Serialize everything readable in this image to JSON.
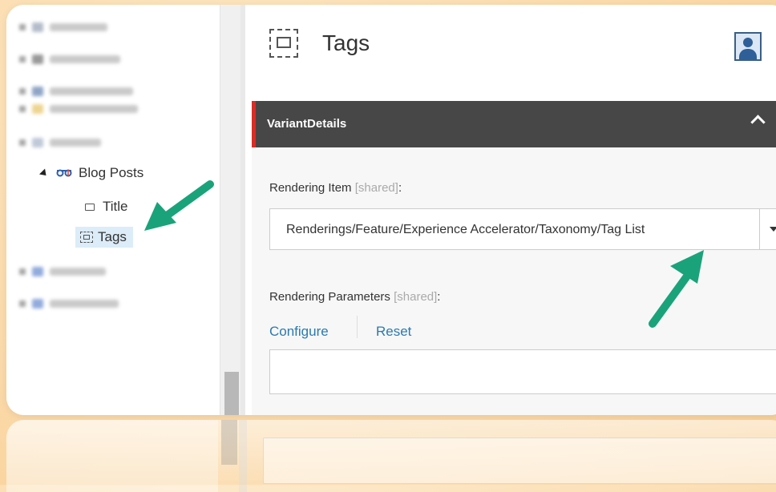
{
  "tree": {
    "blog_posts_label": "Blog Posts",
    "title_label": "Title",
    "tags_label": "Tags"
  },
  "header": {
    "page_title": "Tags"
  },
  "section": {
    "title": "VariantDetails"
  },
  "rendering_item": {
    "label": "Rendering Item",
    "shared": "[shared]",
    "colon": ":",
    "value": "Renderings/Feature/Experience Accelerator/Taxonomy/Tag List"
  },
  "rendering_parameters": {
    "label": "Rendering Parameters",
    "shared": "[shared]",
    "colon": ":",
    "configure_label": "Configure",
    "reset_label": "Reset"
  },
  "colors": {
    "section_bg": "#474747",
    "section_accent": "#d92c26",
    "link": "#2a7ab0",
    "arrow": "#1aa37a",
    "background": "#fbd9a8"
  },
  "icons": {
    "blog_posts": "glasses-icon",
    "title": "rectangle-icon",
    "tags": "dashed-rendering-icon",
    "header": "dashed-rendering-icon",
    "avatar": "user-avatar-icon",
    "collapse": "chevron-up-icon",
    "dropdown": "caret-down-icon"
  }
}
